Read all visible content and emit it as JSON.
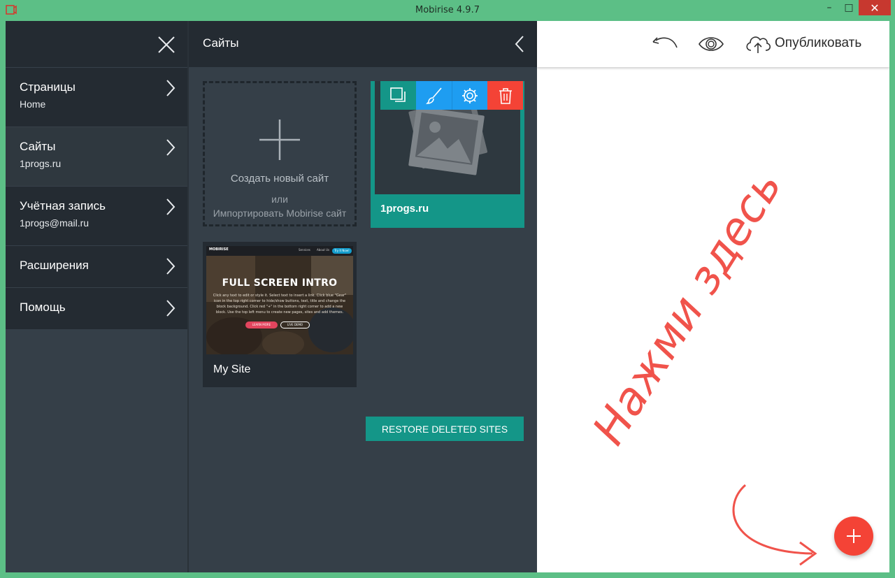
{
  "window": {
    "title": "Mobirise 4.9.7",
    "minimize": "–",
    "maximize": "□",
    "close": "✕"
  },
  "menu": {
    "items": [
      {
        "label": "Страницы",
        "sub": "Home"
      },
      {
        "label": "Сайты",
        "sub": "1progs.ru"
      },
      {
        "label": "Учётная запись",
        "sub": "1progs@mail.ru"
      },
      {
        "label": "Расширения"
      },
      {
        "label": "Помощь"
      }
    ]
  },
  "sites_panel": {
    "title": "Сайты",
    "create": {
      "label": "Создать новый сайт",
      "or": "или",
      "import": "Импортировать Mobirise сайт"
    },
    "sites": [
      {
        "name": "1progs.ru"
      },
      {
        "name": "My Site"
      }
    ],
    "thumb": {
      "brand": "MOBIRISE",
      "link1": "Services",
      "link2": "About Us",
      "try": "Try It Now!",
      "title": "FULL SCREEN INTRO",
      "text": "Click any text to edit or style it. Select text to insert a link. Click blue \"Gear\" icon in the top right corner to hide/show buttons, text, title and change the block background. Click red \"+\" in the bottom right corner to add a new block. Use the top left menu to create new pages, sites and add themes.",
      "learn": "LEARN MORE",
      "live": "LIVE DEMO"
    },
    "restore_label": "RESTORE DELETED SITES"
  },
  "topbar": {
    "publish_label": "Опубликовать"
  },
  "annotation": {
    "text": "Нажми здесь"
  },
  "colors": {
    "frame": "#5cbf86",
    "panel": "#353f48",
    "header": "#242b32",
    "teal": "#149688",
    "blue": "#1e9df1",
    "red": "#f44336"
  },
  "icons": [
    "app-icon",
    "close-icon",
    "chevron-right-icon",
    "chevron-left-icon",
    "plus-icon",
    "duplicate-icon",
    "brush-icon",
    "gear-icon",
    "trash-icon",
    "image-placeholder-icon",
    "undo-icon",
    "eye-icon",
    "cloud-upload-icon",
    "curved-arrow-icon"
  ]
}
